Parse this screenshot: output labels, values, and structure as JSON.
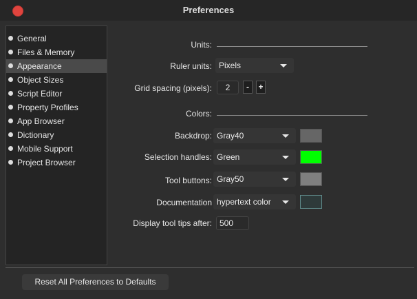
{
  "window": {
    "title": "Preferences"
  },
  "sidebar": {
    "items": [
      {
        "label": "General",
        "selected": false
      },
      {
        "label": "Files & Memory",
        "selected": false
      },
      {
        "label": "Appearance",
        "selected": true
      },
      {
        "label": "Object Sizes",
        "selected": false
      },
      {
        "label": "Script Editor",
        "selected": false
      },
      {
        "label": "Property Profiles",
        "selected": false
      },
      {
        "label": "App Browser",
        "selected": false
      },
      {
        "label": "Dictionary",
        "selected": false
      },
      {
        "label": "Mobile Support",
        "selected": false
      },
      {
        "label": "Project Browser",
        "selected": false
      }
    ]
  },
  "units": {
    "section_label": "Units:",
    "ruler_label": "Ruler units:",
    "ruler_value": "Pixels",
    "grid_label": "Grid spacing (pixels):",
    "grid_value": "2",
    "decrement_label": "-",
    "increment_label": "+"
  },
  "colors": {
    "section_label": "Colors:",
    "backdrop_label": "Backdrop:",
    "backdrop_value": "Gray40",
    "backdrop_color": "#666666",
    "selection_label": "Selection handles:",
    "selection_value": "Green",
    "selection_color": "#00ff00",
    "tool_label": "Tool buttons:",
    "tool_value": "Gray50",
    "tool_color": "#7f7f7f",
    "doc_label": "Documentation",
    "doc_value": "hypertext color",
    "doc_color": "#2e3a3a",
    "tooltips_label": "Display tool tips after:",
    "tooltips_value": "500"
  },
  "footer": {
    "reset_label": "Reset All Preferences to Defaults"
  }
}
